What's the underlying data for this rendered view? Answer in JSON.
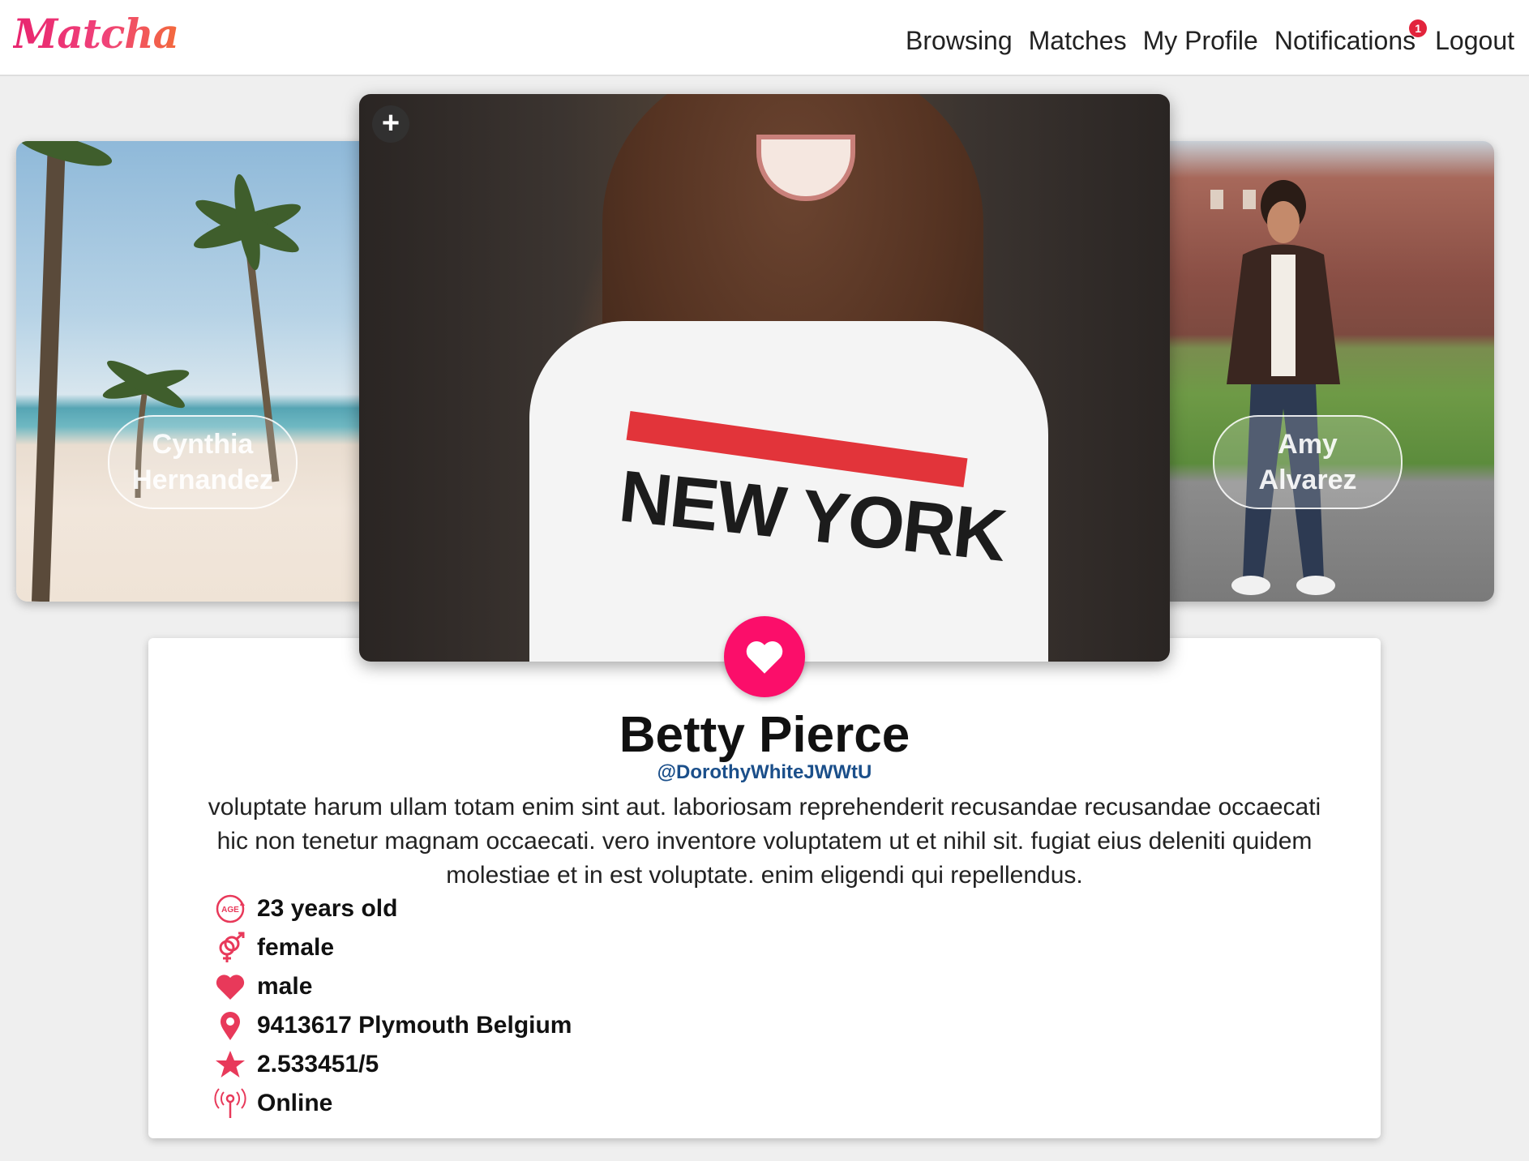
{
  "app": {
    "logo": "Matcha"
  },
  "nav": {
    "browsing": "Browsing",
    "matches": "Matches",
    "my_profile": "My Profile",
    "notifications": "Notifications",
    "notifications_count": "1",
    "logout": "Logout"
  },
  "carousel": {
    "prev": {
      "first_name": "Cynthia",
      "last_name": "Hernandez"
    },
    "current_add": "+",
    "next": {
      "first_name": "Amy",
      "last_name": "Alvarez"
    },
    "shirt_text": "NEW YORK"
  },
  "profile": {
    "name": "Betty Pierce",
    "username": "@DorothyWhiteJWWtU",
    "bio": "voluptate harum ullam totam enim sint aut. laboriosam reprehenderit recusandae recusandae occaecati hic non tenetur magnam occaecati. vero inventore voluptatem ut et nihil sit. fugiat eius deleniti quidem molestiae et in est voluptate. enim eligendi qui repellendus.",
    "age_icon_text": "AGE",
    "details": {
      "age": "23 years old",
      "gender": "female",
      "interest": "male",
      "location": "9413617 Plymouth Belgium",
      "rating": "2.533451/5",
      "status": "Online"
    }
  },
  "colors": {
    "accent": "#e8395a",
    "like_button": "#fb0e6a",
    "username": "#1b4f8a",
    "badge": "#e2243c"
  },
  "icons": {
    "age": "age-icon",
    "gender": "gender-icon",
    "interest": "heart-icon",
    "location": "location-pin-icon",
    "rating": "star-icon",
    "status": "broadcast-icon",
    "like": "heart-icon",
    "add": "plus-icon"
  }
}
